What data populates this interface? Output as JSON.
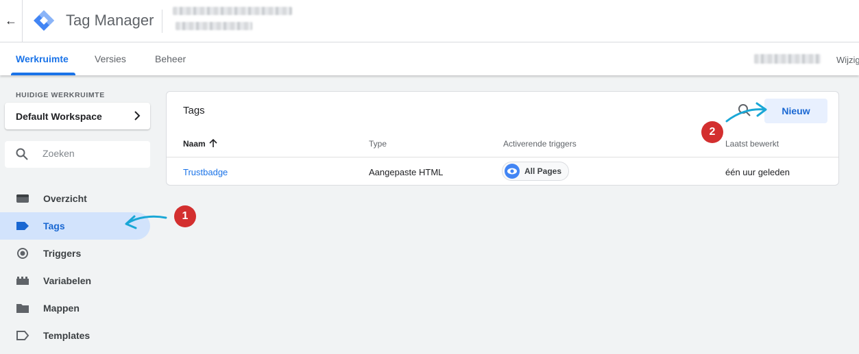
{
  "header": {
    "back_icon": "arrow-left-icon",
    "app_title": "Tag Manager",
    "logo_icon": "tag-manager-logo-icon"
  },
  "tabs": {
    "items": [
      {
        "label": "Werkruimte"
      },
      {
        "label": "Versies"
      },
      {
        "label": "Beheer"
      }
    ],
    "right_action": "Wijzig"
  },
  "sidebar": {
    "workspace_heading": "HUIDIGE WERKRUIMTE",
    "workspace_name": "Default Workspace",
    "search_placeholder": "Zoeken",
    "items": [
      {
        "label": "Overzicht",
        "icon": "overview-icon"
      },
      {
        "label": "Tags",
        "icon": "tag-icon"
      },
      {
        "label": "Triggers",
        "icon": "trigger-icon"
      },
      {
        "label": "Variabelen",
        "icon": "variables-icon"
      },
      {
        "label": "Mappen",
        "icon": "folder-icon"
      },
      {
        "label": "Templates",
        "icon": "template-icon"
      }
    ]
  },
  "tags_card": {
    "title": "Tags",
    "new_button": "Nieuw",
    "columns": [
      "Naam",
      "Type",
      "Activerende triggers",
      "Laatst bewerkt"
    ],
    "rows": [
      {
        "name": "Trustbadge",
        "type": "Aangepaste HTML",
        "trigger": "All Pages",
        "edited": "één uur geleden"
      }
    ]
  },
  "annotations": [
    "1",
    "2"
  ],
  "colors": {
    "accent": "#1a73e8",
    "active_nav_bg": "#d2e3fc",
    "badge_red": "#d32f2f",
    "arrow_cyan": "#1aa7d6"
  }
}
